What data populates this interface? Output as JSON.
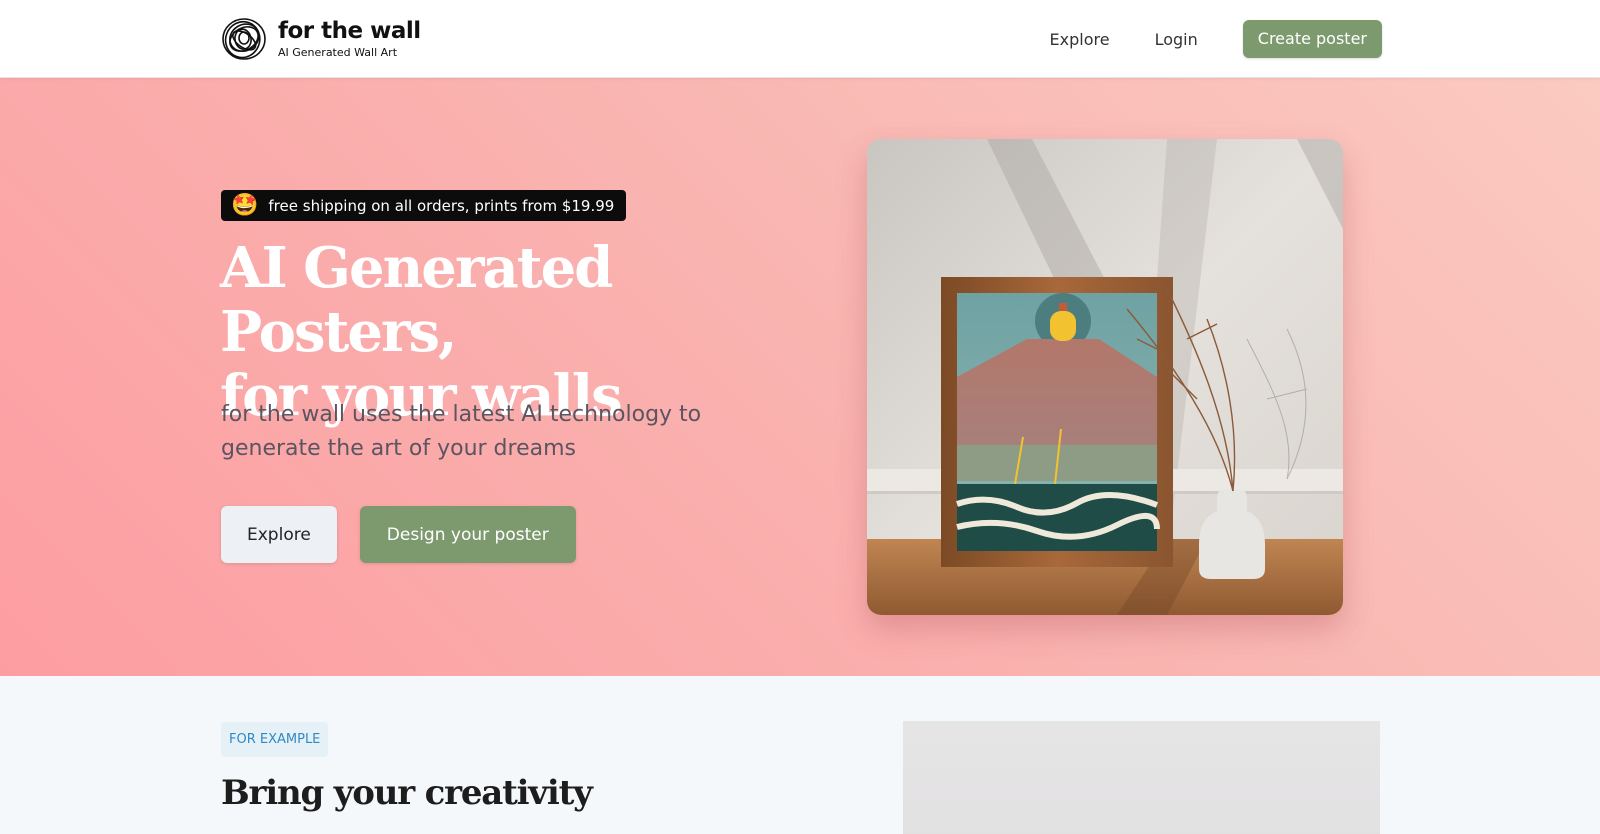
{
  "header": {
    "logo_title": "for the wall",
    "logo_subtitle": "AI Generated Wall Art",
    "nav": {
      "explore_label": "Explore",
      "login_label": "Login",
      "create_label": "Create poster"
    }
  },
  "hero": {
    "badge_emoji": "🤩",
    "badge_text": "free shipping on all orders, prints from $19.99",
    "title_line1": "AI Generated Posters,",
    "title_line2": "for your walls",
    "description": "for the wall uses the latest AI technology to generate the art of your dreams",
    "explore_button": "Explore",
    "design_button": "Design your poster",
    "image_alt": "framed poster mockup"
  },
  "section": {
    "eyebrow": "FOR EXAMPLE",
    "title": "Bring your creativity"
  },
  "colors": {
    "accent_green": "#7c9a6e",
    "hero_gradient_start": "#fd9da2",
    "hero_gradient_end": "#fbcac1",
    "eyebrow_text": "#2f8ac4"
  }
}
